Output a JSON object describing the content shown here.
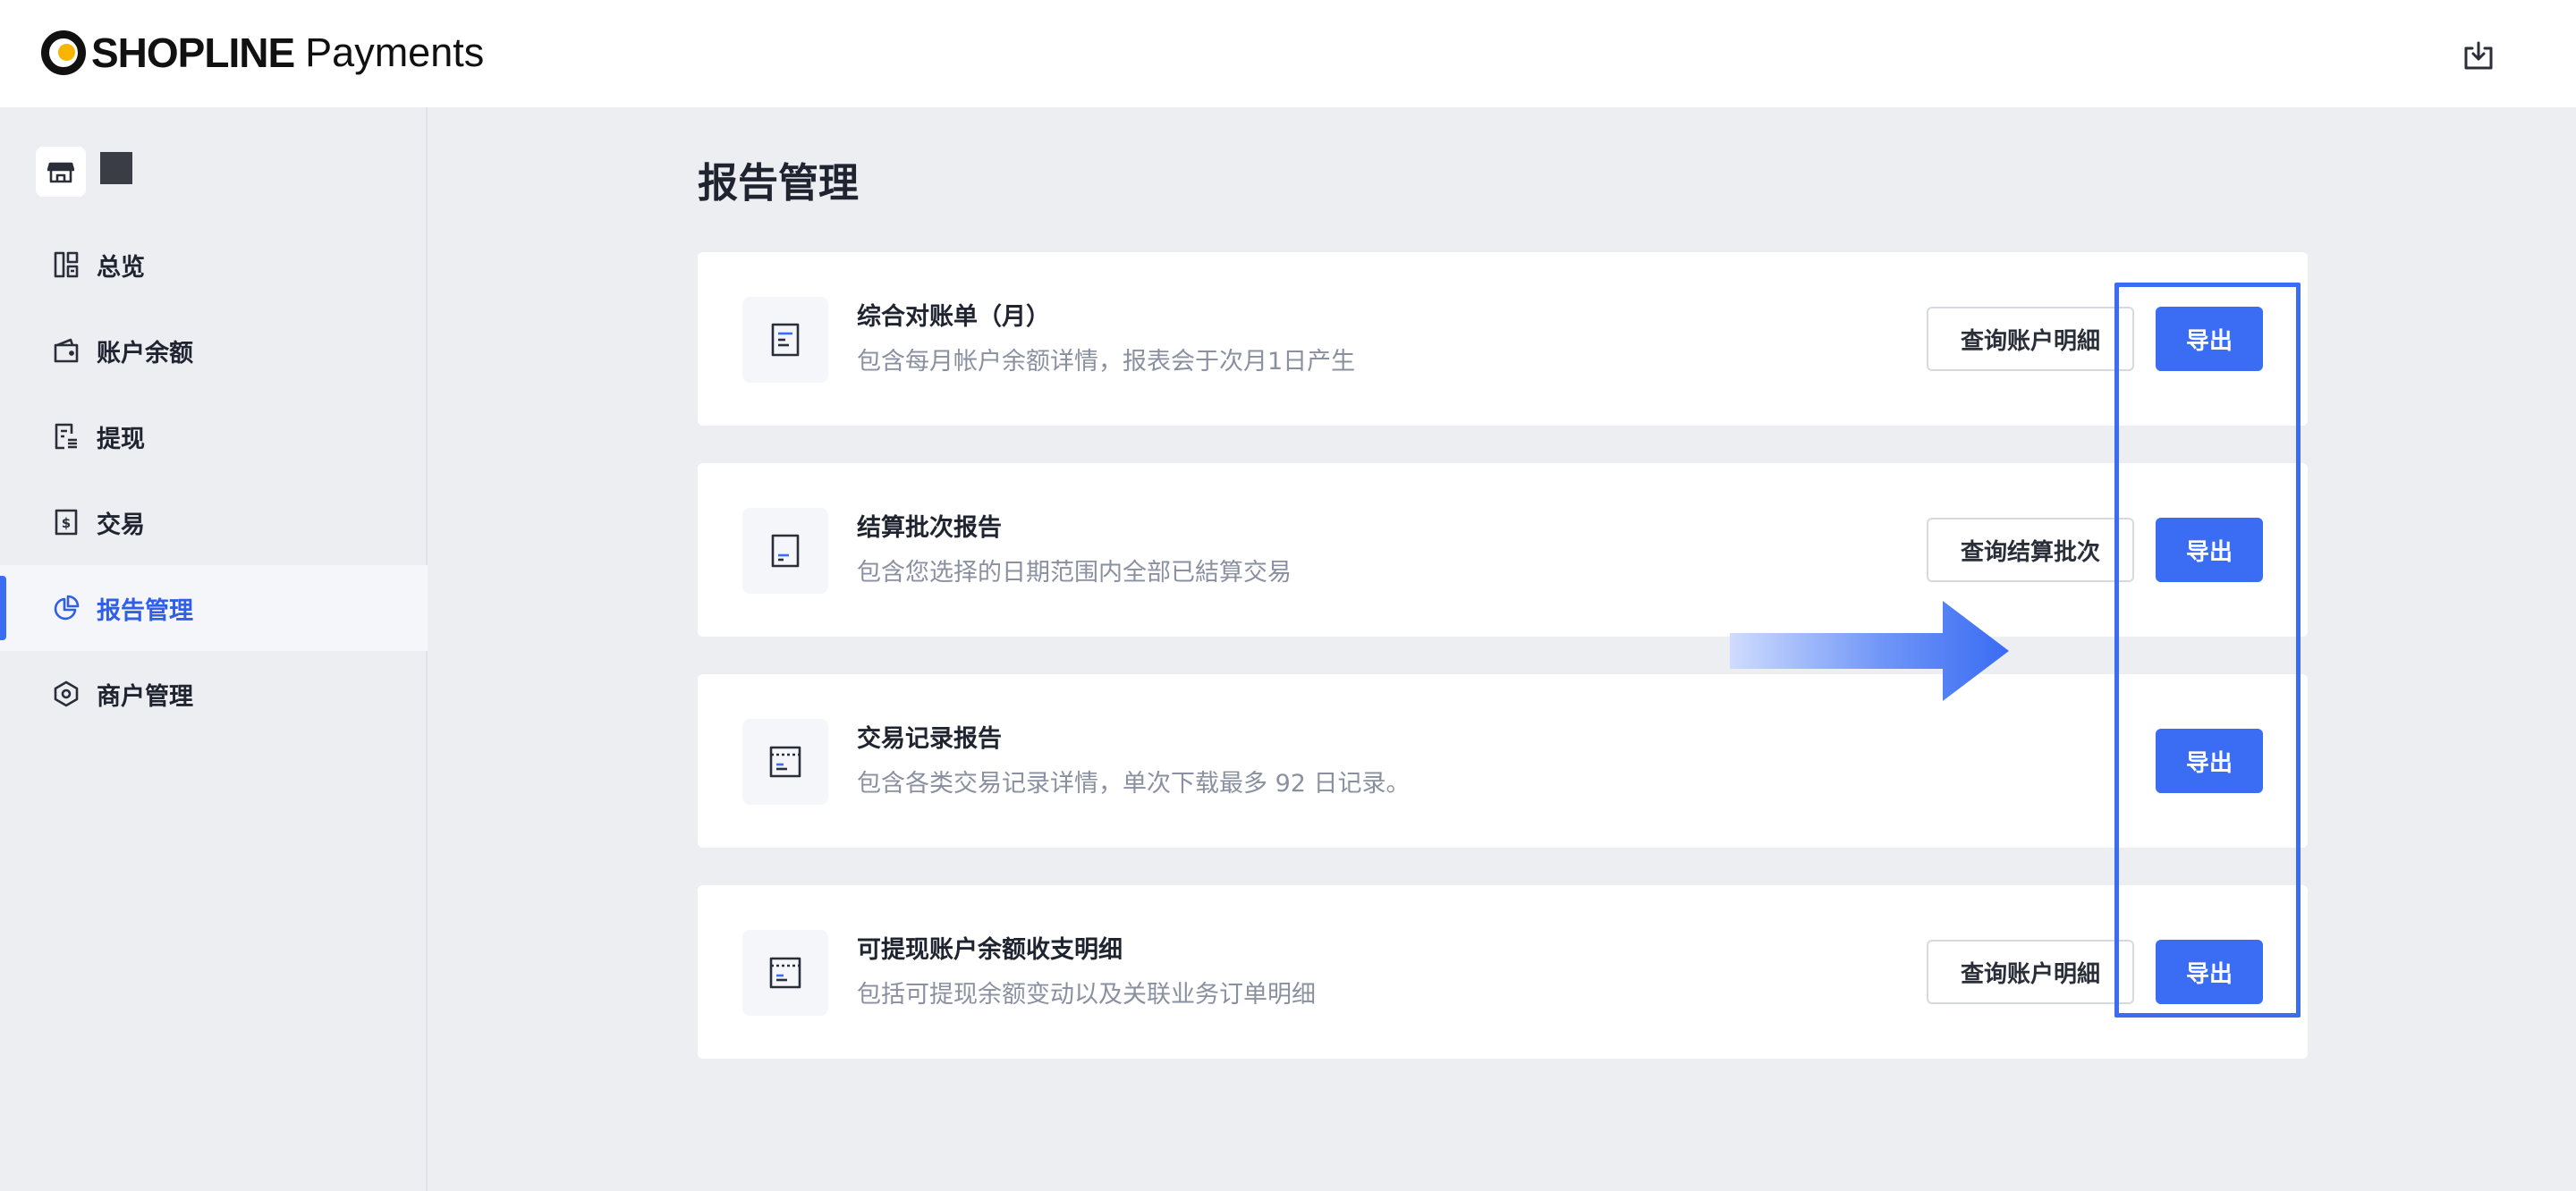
{
  "header": {
    "brand": "SHOPLINE",
    "product": "Payments",
    "download_icon": "download-tray-icon"
  },
  "sidebar": {
    "store_icon": "storefront-icon",
    "items": [
      {
        "label": "总览",
        "icon": "dashboard-icon",
        "active": false
      },
      {
        "label": "账户余额",
        "icon": "wallet-icon",
        "active": false
      },
      {
        "label": "提现",
        "icon": "withdraw-document-icon",
        "active": false
      },
      {
        "label": "交易",
        "icon": "dollar-receipt-icon",
        "active": false
      },
      {
        "label": "报告管理",
        "icon": "pie-chart-icon",
        "active": true
      },
      {
        "label": "商户管理",
        "icon": "hexagon-settings-icon",
        "active": false
      }
    ]
  },
  "main": {
    "title": "报告管理",
    "reports": [
      {
        "title": "综合对账单（月）",
        "description": "包含每月帐户余额详情，报表会于次月1日产生",
        "secondary_button": "查询账户明細",
        "export_button": "导出",
        "icon": "statement-document-icon"
      },
      {
        "title": "结算批次报告",
        "description": "包含您选择的日期范围内全部已結算交易",
        "secondary_button": "查询结算批次",
        "export_button": "导出",
        "icon": "settlement-document-icon"
      },
      {
        "title": "交易记录报告",
        "description": "包含各类交易记录详情，单次下载最多 92 日记录。",
        "secondary_button": "",
        "export_button": "导出",
        "icon": "transaction-record-icon"
      },
      {
        "title": "可提现账户余额收支明细",
        "description": "包括可提现余额变动以及关联业务订单明细",
        "secondary_button": "查询账户明細",
        "export_button": "导出",
        "icon": "balance-detail-icon"
      }
    ]
  },
  "colors": {
    "accent": "#3a6cf4",
    "background": "#eceef2",
    "card": "#ffffff",
    "muted_text": "#8a90a0"
  }
}
